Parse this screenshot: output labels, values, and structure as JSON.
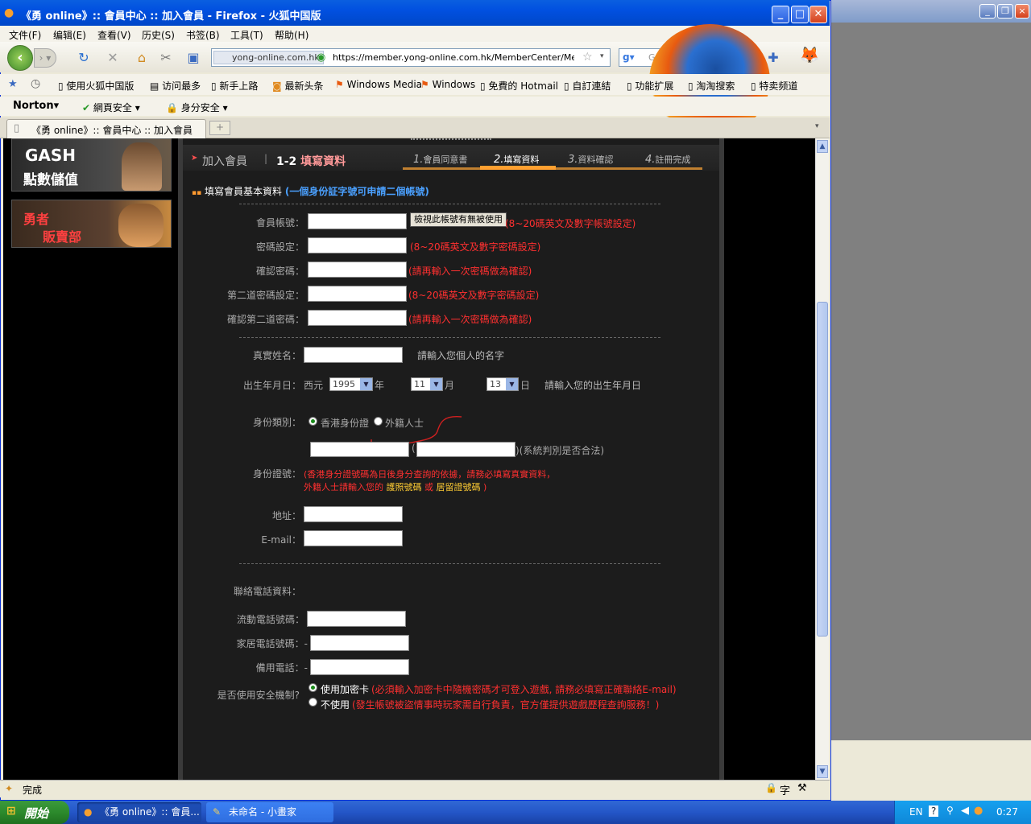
{
  "window": {
    "title": "《勇 online》:: 會員中心 :: 加入會員 - Firefox - 火狐中国版"
  },
  "menu": [
    "文件(F)",
    "编辑(E)",
    "查看(V)",
    "历史(S)",
    "书签(B)",
    "工具(T)",
    "帮助(H)"
  ],
  "nav": {
    "site_badge": "yong-online.com.hk",
    "url": "https://member.yong-online.com.hk/MemberCenter/Member_inp",
    "search_placeholder": "Google"
  },
  "bookmarks": [
    "使用火狐中国版",
    "访问最多",
    "新手上路",
    "最新头条",
    "Windows Media",
    "Windows",
    "免費的 Hotmail",
    "自訂連結",
    "功能扩展",
    "淘淘搜索",
    "特卖频道"
  ],
  "norton": {
    "logo": "Norton",
    "web_safety": "網頁安全",
    "identity_safety": "身分安全"
  },
  "tab": {
    "title": "《勇 online》:: 會員中心 :: 加入會員",
    "new_tab": "+"
  },
  "banners": {
    "gash_title": "GASH",
    "gash_sub": "點數儲值",
    "shop_line1": "勇者",
    "shop_line2": "販賣部"
  },
  "panel": {
    "header_left": "加入會員",
    "header_step": "1-2",
    "header_title": "填寫資料",
    "steps": [
      {
        "num": "1.",
        "label": "會員同意書"
      },
      {
        "num": "2.",
        "label": "填寫資料"
      },
      {
        "num": "3.",
        "label": "資料確認"
      },
      {
        "num": "4.",
        "label": "註冊完成"
      }
    ],
    "section_title": "填寫會員基本資料",
    "section_note": "(一個身份証字號可申請二個帳號)"
  },
  "form": {
    "account_label": "會員帳號：",
    "check_button": "檢視此帳號有無被使用",
    "account_hint": "(8~20碼英文及數字帳號設定)",
    "password_label": "密碼設定：",
    "password_hint": "(8~20碼英文及數字密碼設定)",
    "confirm_label": "確認密碼：",
    "confirm_hint": "(請再輸入一次密碼做為確認)",
    "pw2_label": "第二道密碼設定：",
    "pw2_hint": "(8~20碼英文及數字密碼設定)",
    "pw2_confirm_label": "確認第二道密碼：",
    "pw2_confirm_hint": "(請再輸入一次密碼做為確認)",
    "name_label": "真實姓名：",
    "name_hint": "請輸入您個人的名字",
    "birth_label": "出生年月日：",
    "birth_era": "西元",
    "birth_year": "1995",
    "year_unit": "年",
    "birth_month": "11",
    "month_unit": "月",
    "birth_day": "13",
    "day_unit": "日",
    "birth_hint": "請輸入您的出生年月日",
    "id_type_label": "身份類別：",
    "id_type_hk": "香港身份證",
    "id_type_foreign": "外籍人士",
    "id_paren_open": "(",
    "id_system_hint": ")(系統判別是否合法)",
    "id_label": "身份證號：",
    "id_note_line1": "(香港身分證號碼為日後身分查詢的依據，請務必填寫真實資料，",
    "id_note_line2a": "外籍人士請輸入您的",
    "id_note_passport": "護照號碼",
    "id_note_or": "或",
    "id_note_residence": "居留證號碼",
    "id_note_close": ")",
    "address_label": "地址：",
    "email_label": "E-mail：",
    "phone_section_label": "聯絡電話資料：",
    "mobile_label": "流動電話號碼：",
    "home_label": "家居電話號碼：-",
    "backup_label": "備用電話：-",
    "security_label": "是否使用安全機制?",
    "security_use": "使用加密卡",
    "security_use_note": "(必須輸入加密卡中隨機密碼才可登入遊戲, 請務必填寫正確聯絡E-mail)",
    "security_none": "不使用",
    "security_none_note": "(發生帳號被盜情事時玩家需自行負責，官方僅提供遊戲歷程查詢服務！)"
  },
  "status": {
    "text": "完成"
  },
  "taskbar": {
    "start": "開始",
    "items": [
      "《勇 online》:: 會員...",
      "未命名 - 小畫家"
    ],
    "lang": "EN",
    "clock": "0:27"
  },
  "colors": {
    "title_blue": "#0a5fe0",
    "panel_bg": "#1c1c1c",
    "hint_red": "#ff3030",
    "note_blue": "#4aa0ff",
    "step_bar": "#c08030",
    "highlight_yellow": "#ffcc33"
  }
}
